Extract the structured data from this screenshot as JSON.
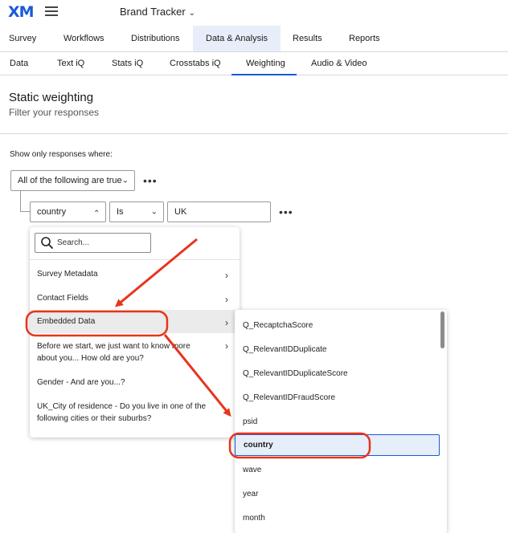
{
  "app": {
    "logo": "XM",
    "project_name": "Brand Tracker"
  },
  "main_tabs": [
    {
      "label": "Survey"
    },
    {
      "label": "Workflows"
    },
    {
      "label": "Distributions"
    },
    {
      "label": "Data & Analysis",
      "active": true
    },
    {
      "label": "Results"
    },
    {
      "label": "Reports"
    }
  ],
  "sub_tabs": [
    {
      "label": "Data"
    },
    {
      "label": "Text iQ"
    },
    {
      "label": "Stats iQ"
    },
    {
      "label": "Crosstabs iQ"
    },
    {
      "label": "Weighting",
      "active": true
    },
    {
      "label": "Audio & Video"
    }
  ],
  "header": {
    "title": "Static weighting",
    "subtitle": "Filter your responses"
  },
  "filter": {
    "show_label": "Show only responses where:",
    "logic_select": "All of the following are true",
    "field_select": "country",
    "operator_select": "Is",
    "value_input": "UK",
    "more": "•••"
  },
  "dropdown": {
    "search_placeholder": "Search...",
    "items": [
      {
        "label": "Survey Metadata"
      },
      {
        "label": "Contact Fields"
      },
      {
        "label": "Embedded Data"
      },
      {
        "label": "Before we start, we just want to know more about you... How old are you?"
      },
      {
        "label": "Gender - And are you...?"
      },
      {
        "label": "UK_City of residence - Do you live in one of the following cities or their suburbs?"
      }
    ]
  },
  "submenu": {
    "items": [
      {
        "label": "Q_RecaptchaScore"
      },
      {
        "label": "Q_RelevantIDDuplicate"
      },
      {
        "label": "Q_RelevantIDDuplicateScore"
      },
      {
        "label": "Q_RelevantIDFraudScore"
      },
      {
        "label": "psid"
      },
      {
        "label": "country",
        "selected": true
      },
      {
        "label": "wave"
      },
      {
        "label": "year"
      },
      {
        "label": "month"
      }
    ]
  },
  "colors": {
    "accent": "#1b5ad8",
    "annotation": "#e8341c"
  },
  "icons": {
    "hamburger": "hamburger-icon",
    "chevron": "chevron-down-icon",
    "search": "search-icon",
    "submenu_arrow": "chevron-right-icon"
  }
}
